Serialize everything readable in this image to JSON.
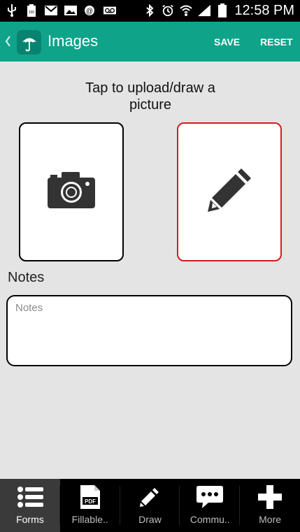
{
  "status_bar": {
    "time": "12:58 PM",
    "battery_badge": "100",
    "icons": [
      "usb-icon",
      "battery-full-icon",
      "gmail-icon",
      "image-icon",
      "mail-alert-icon",
      "voicemail-icon",
      "bluetooth-icon",
      "alarm-icon",
      "wifi-icon",
      "signal-icon",
      "battery-icon"
    ]
  },
  "app_bar": {
    "title": "Images",
    "save_label": "SAVE",
    "reset_label": "RESET",
    "color": "#0fa38a"
  },
  "main": {
    "instruction": "Tap to upload/draw a picture",
    "upload_card": {
      "icon": "camera-icon",
      "border_color": "#000000"
    },
    "draw_card": {
      "icon": "pencil-icon",
      "border_color": "#d91a1a"
    },
    "notes_label": "Notes",
    "notes_placeholder": "Notes",
    "notes_value": ""
  },
  "tabs": [
    {
      "label": "Forms",
      "icon": "list-icon",
      "active": true
    },
    {
      "label": "Fillable..",
      "icon": "pdf-icon",
      "badge": "PDF",
      "active": false
    },
    {
      "label": "Draw",
      "icon": "pencil-icon",
      "active": false
    },
    {
      "label": "Commu..",
      "icon": "chat-bubble-icon",
      "active": false
    },
    {
      "label": "More",
      "icon": "plus-icon",
      "active": false
    }
  ]
}
